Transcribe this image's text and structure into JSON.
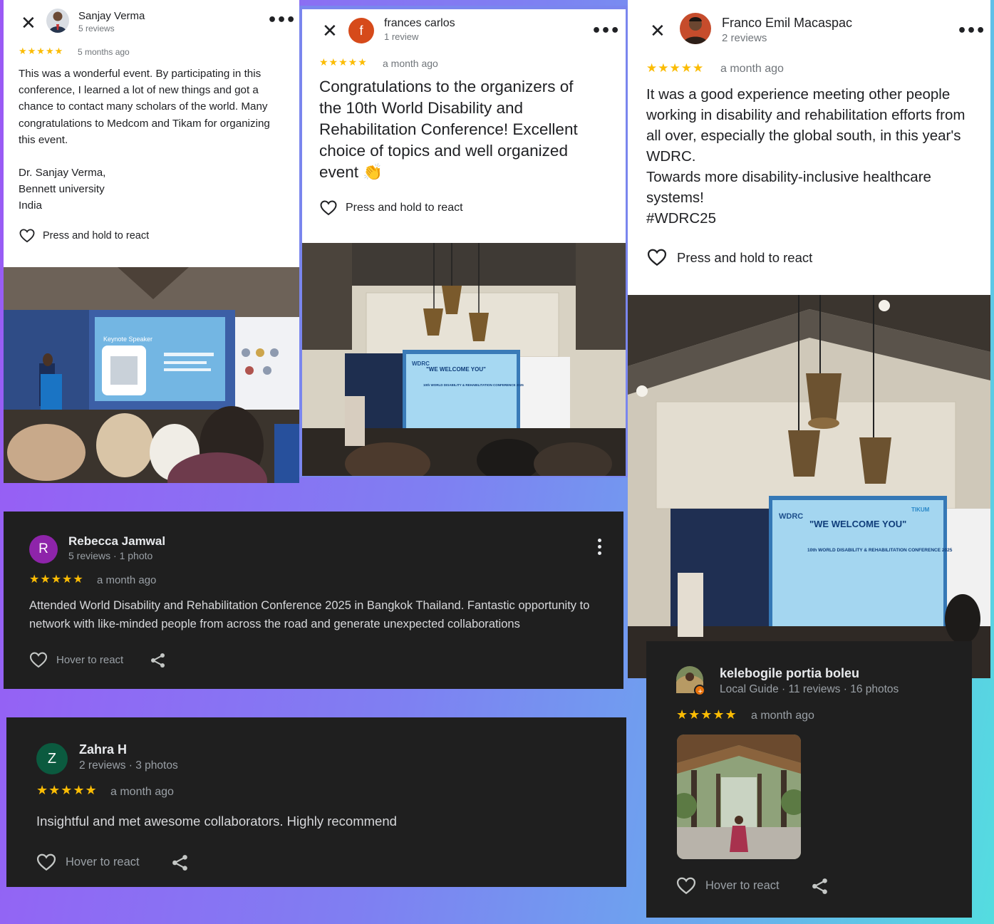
{
  "colors": {
    "star": "#fbbc04",
    "light_card_bg": "#ffffff",
    "dark_card_bg": "#1f1f1f",
    "bg_gradient_start": "#9b59f5",
    "bg_gradient_end": "#54dde0"
  },
  "reviews": {
    "sanjay": {
      "name": "Sanjay Verma",
      "meta": "5 reviews",
      "stars": "★★★★★",
      "time": "5 months ago",
      "paragraphs": [
        "This was a wonderful event. By participating in this conference, I learned a lot of new things and got a chance to contact many scholars of the world. Many congratulations to Medcom and Tikam for organizing this event.",
        "Dr. Sanjay Verma,",
        "Bennett university",
        "India"
      ],
      "react_label": "Press and hold to react",
      "photo": {
        "slide_title": "Keynote Speaker"
      }
    },
    "frances": {
      "avatar_letter": "f",
      "name": "frances carlos",
      "meta": "1 review",
      "stars": "★★★★★",
      "time": "a month ago",
      "text": "Congratulations to the organizers of the 10th World Disability and Rehabilitation Conference! Excellent choice of topics and well organized event 👏",
      "react_label": "Press and hold to react",
      "photo": {
        "screen_line1": "\"WE WELCOME YOU\"",
        "screen_line2": "10th WORLD DISABILITY & REHABILITATION CONFERENCE 2025",
        "screen_brand": "WDRC"
      }
    },
    "franco": {
      "name": "Franco Emil Macaspac",
      "meta": "2 reviews",
      "stars": "★★★★★",
      "time": "a month ago",
      "lines": [
        "It was a good experience meeting other people working in disability and rehabilitation efforts from all over, especially the global south, in this year's WDRC.",
        "Towards more disability-inclusive healthcare systems!",
        "#WDRC25"
      ],
      "react_label": "Press and hold to react",
      "photo": {
        "screen_line1": "\"WE WELCOME YOU\"",
        "screen_line2": "10th WORLD DISABILITY & REHABILITATION CONFERENCE 2025",
        "screen_brand": "WDRC",
        "screen_logo": "TIKUM"
      }
    },
    "rebecca": {
      "avatar_letter": "R",
      "name": "Rebecca Jamwal",
      "meta": "5 reviews · 1 photo",
      "stars": "★★★★★",
      "time": "a month ago",
      "text": "Attended World Disability and Rehabilitation Conference 2025 in Bangkok Thailand. Fantastic opportunity to network with like-minded people from across the road and generate unexpected collaborations",
      "react_label": "Hover to react"
    },
    "zahra": {
      "avatar_letter": "Z",
      "name": "Zahra H",
      "meta": "2 reviews · 3 photos",
      "stars": "★★★★★",
      "time": "a month ago",
      "text": "Insightful and met awesome collaborators. Highly recommend",
      "react_label": "Hover to react"
    },
    "kelebogile": {
      "name": "kelebogile portia boleu",
      "meta": "Local Guide · 11 reviews · 16 photos",
      "stars": "★★★★★",
      "time": "a month ago",
      "react_label": "Hover to react"
    }
  }
}
